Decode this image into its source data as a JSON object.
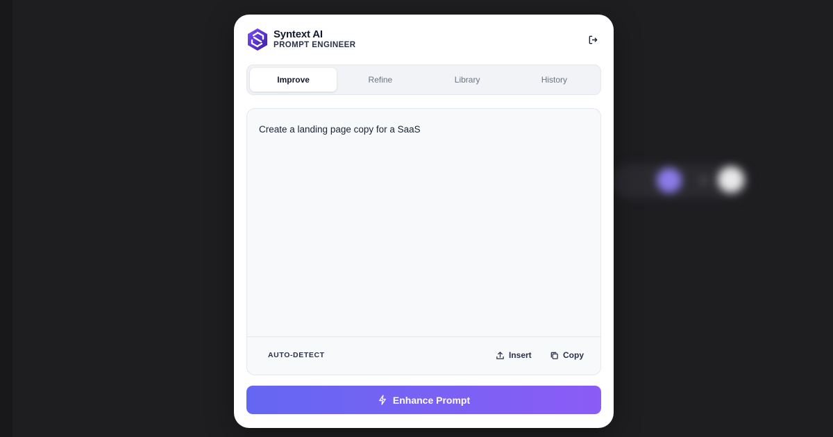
{
  "brand": {
    "title": "Syntext AI",
    "subtitle": "PROMPT ENGINEER"
  },
  "tabs": [
    {
      "label": "Improve",
      "active": true
    },
    {
      "label": "Refine",
      "active": false
    },
    {
      "label": "Library",
      "active": false
    },
    {
      "label": "History",
      "active": false
    }
  ],
  "editor": {
    "value": "Create a landing page copy for a SaaS",
    "mode": "AUTO-DETECT",
    "insert_label": "Insert",
    "copy_label": "Copy"
  },
  "enhance_label": "Enhance Prompt",
  "colors": {
    "accent_start": "#6467f2",
    "accent_end": "#8b5cf6",
    "background": "#1e1e21"
  },
  "icons": [
    "logo-icon",
    "logout-icon",
    "upload-icon",
    "copy-icon",
    "bolt-icon"
  ]
}
